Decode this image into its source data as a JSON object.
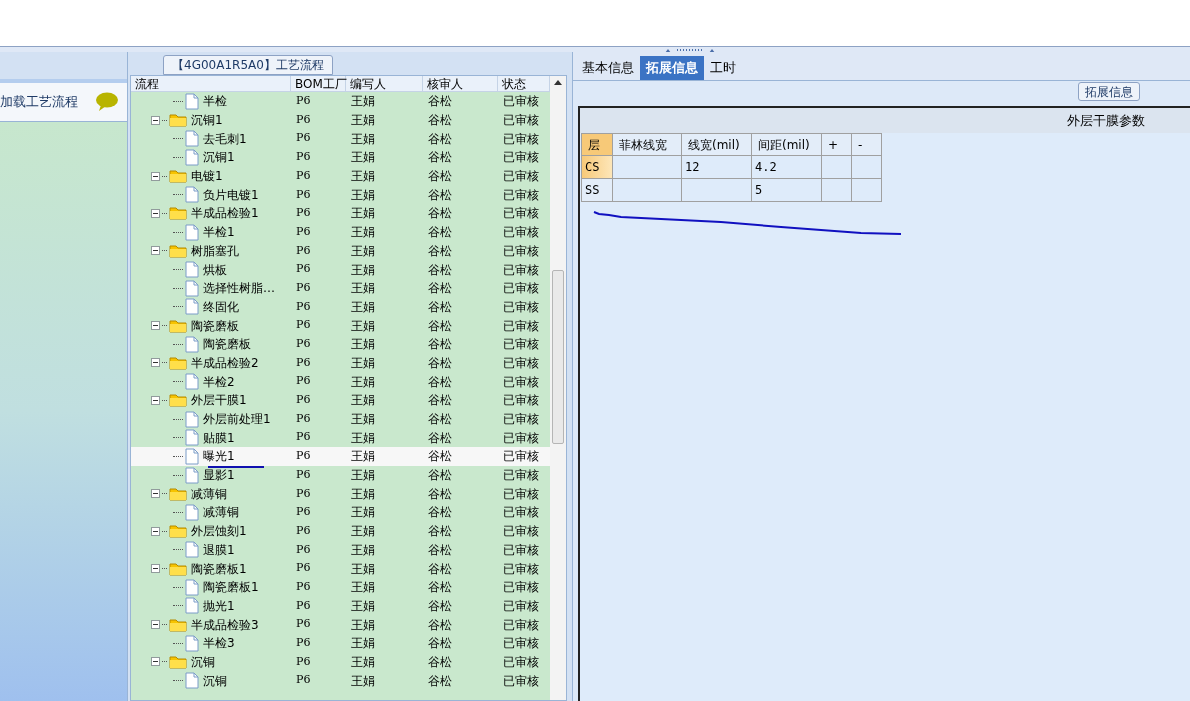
{
  "left_panel": {
    "header": "加载工艺流程"
  },
  "process_panel": {
    "title": "【4G00A1R5A0】工艺流程",
    "columns": [
      "流程",
      "BOM工厂",
      "编写人",
      "核审人",
      "状态"
    ],
    "rows": [
      {
        "kind": "file",
        "name": "半检",
        "bom": "P6",
        "writer": "王娟",
        "reviewer": "谷松",
        "status": "已审核",
        "selected": false
      },
      {
        "kind": "folder",
        "name": "沉铜1",
        "bom": "P6",
        "writer": "王娟",
        "reviewer": "谷松",
        "status": "已审核",
        "selected": false,
        "expanded": true,
        "children": [
          {
            "kind": "file",
            "name": "去毛刺1",
            "bom": "P6",
            "writer": "王娟",
            "reviewer": "谷松",
            "status": "已审核",
            "selected": false
          },
          {
            "kind": "file",
            "name": "沉铜1",
            "bom": "P6",
            "writer": "王娟",
            "reviewer": "谷松",
            "status": "已审核",
            "selected": false
          }
        ]
      },
      {
        "kind": "folder",
        "name": "电镀1",
        "bom": "P6",
        "writer": "王娟",
        "reviewer": "谷松",
        "status": "已审核",
        "selected": false,
        "expanded": true,
        "children": [
          {
            "kind": "file",
            "name": "负片电镀1",
            "bom": "P6",
            "writer": "王娟",
            "reviewer": "谷松",
            "status": "已审核",
            "selected": false
          }
        ]
      },
      {
        "kind": "folder",
        "name": "半成品检验1",
        "bom": "P6",
        "writer": "王娟",
        "reviewer": "谷松",
        "status": "已审核",
        "selected": false,
        "expanded": true,
        "children": [
          {
            "kind": "file",
            "name": "半检1",
            "bom": "P6",
            "writer": "王娟",
            "reviewer": "谷松",
            "status": "已审核",
            "selected": false
          }
        ]
      },
      {
        "kind": "folder",
        "name": "树脂塞孔",
        "bom": "P6",
        "writer": "王娟",
        "reviewer": "谷松",
        "status": "已审核",
        "selected": false,
        "expanded": true,
        "children": [
          {
            "kind": "file",
            "name": "烘板",
            "bom": "P6",
            "writer": "王娟",
            "reviewer": "谷松",
            "status": "已审核",
            "selected": false
          },
          {
            "kind": "file",
            "name": "选择性树脂…",
            "bom": "P6",
            "writer": "王娟",
            "reviewer": "谷松",
            "status": "已审核",
            "selected": false
          },
          {
            "kind": "file",
            "name": "终固化",
            "bom": "P6",
            "writer": "王娟",
            "reviewer": "谷松",
            "status": "已审核",
            "selected": false
          }
        ]
      },
      {
        "kind": "folder",
        "name": "陶瓷磨板",
        "bom": "P6",
        "writer": "王娟",
        "reviewer": "谷松",
        "status": "已审核",
        "selected": false,
        "expanded": true,
        "children": [
          {
            "kind": "file",
            "name": "陶瓷磨板",
            "bom": "P6",
            "writer": "王娟",
            "reviewer": "谷松",
            "status": "已审核",
            "selected": false
          }
        ]
      },
      {
        "kind": "folder",
        "name": "半成品检验2",
        "bom": "P6",
        "writer": "王娟",
        "reviewer": "谷松",
        "status": "已审核",
        "selected": false,
        "expanded": true,
        "children": [
          {
            "kind": "file",
            "name": "半检2",
            "bom": "P6",
            "writer": "王娟",
            "reviewer": "谷松",
            "status": "已审核",
            "selected": false
          }
        ]
      },
      {
        "kind": "folder",
        "name": "外层干膜1",
        "bom": "P6",
        "writer": "王娟",
        "reviewer": "谷松",
        "status": "已审核",
        "selected": false,
        "expanded": true,
        "children": [
          {
            "kind": "file",
            "name": "外层前处理1",
            "bom": "P6",
            "writer": "王娟",
            "reviewer": "谷松",
            "status": "已审核",
            "selected": false
          },
          {
            "kind": "file",
            "name": "贴膜1",
            "bom": "P6",
            "writer": "王娟",
            "reviewer": "谷松",
            "status": "已审核",
            "selected": false
          },
          {
            "kind": "file",
            "name": "曝光1",
            "bom": "P6",
            "writer": "王娟",
            "reviewer": "谷松",
            "status": "已审核",
            "selected": true
          },
          {
            "kind": "file",
            "name": "显影1",
            "bom": "P6",
            "writer": "王娟",
            "reviewer": "谷松",
            "status": "已审核",
            "selected": false
          }
        ]
      },
      {
        "kind": "folder",
        "name": "减薄铜",
        "bom": "P6",
        "writer": "王娟",
        "reviewer": "谷松",
        "status": "已审核",
        "selected": false,
        "expanded": true,
        "children": [
          {
            "kind": "file",
            "name": "减薄铜",
            "bom": "P6",
            "writer": "王娟",
            "reviewer": "谷松",
            "status": "已审核",
            "selected": false
          }
        ]
      },
      {
        "kind": "folder",
        "name": "外层蚀刻1",
        "bom": "P6",
        "writer": "王娟",
        "reviewer": "谷松",
        "status": "已审核",
        "selected": false,
        "expanded": true,
        "children": [
          {
            "kind": "file",
            "name": "退膜1",
            "bom": "P6",
            "writer": "王娟",
            "reviewer": "谷松",
            "status": "已审核",
            "selected": false
          }
        ]
      },
      {
        "kind": "folder",
        "name": "陶瓷磨板1",
        "bom": "P6",
        "writer": "王娟",
        "reviewer": "谷松",
        "status": "已审核",
        "selected": false,
        "expanded": true,
        "children": [
          {
            "kind": "file",
            "name": "陶瓷磨板1",
            "bom": "P6",
            "writer": "王娟",
            "reviewer": "谷松",
            "status": "已审核",
            "selected": false
          },
          {
            "kind": "file",
            "name": "抛光1",
            "bom": "P6",
            "writer": "王娟",
            "reviewer": "谷松",
            "status": "已审核",
            "selected": false
          }
        ]
      },
      {
        "kind": "folder",
        "name": "半成品检验3",
        "bom": "P6",
        "writer": "王娟",
        "reviewer": "谷松",
        "status": "已审核",
        "selected": false,
        "expanded": true,
        "children": [
          {
            "kind": "file",
            "name": "半检3",
            "bom": "P6",
            "writer": "王娟",
            "reviewer": "谷松",
            "status": "已审核",
            "selected": false
          }
        ]
      },
      {
        "kind": "folder",
        "name": "沉铜",
        "bom": "P6",
        "writer": "王娟",
        "reviewer": "谷松",
        "status": "已审核",
        "selected": false,
        "expanded": true,
        "children": [
          {
            "kind": "file",
            "name": "沉铜",
            "bom": "P6",
            "writer": "王娟",
            "reviewer": "谷松",
            "status": "已审核",
            "selected": false
          }
        ]
      }
    ]
  },
  "detail_panel": {
    "tabs": [
      {
        "label": "基本信息",
        "selected": false
      },
      {
        "label": "拓展信息",
        "selected": true
      },
      {
        "label": "工时",
        "selected": false
      }
    ],
    "group_title": "拓展信息",
    "section_title": "外层干膜参数",
    "grid": {
      "columns": [
        "层",
        "菲林线宽",
        "线宽(mil)",
        "间距(mil)",
        "+",
        "-"
      ],
      "rows": [
        {
          "selected": true,
          "cells": [
            "CS",
            "",
            "12",
            "4.2",
            "",
            ""
          ]
        },
        {
          "selected": false,
          "cells": [
            "SS",
            "",
            "",
            "5",
            "",
            ""
          ]
        }
      ]
    }
  }
}
